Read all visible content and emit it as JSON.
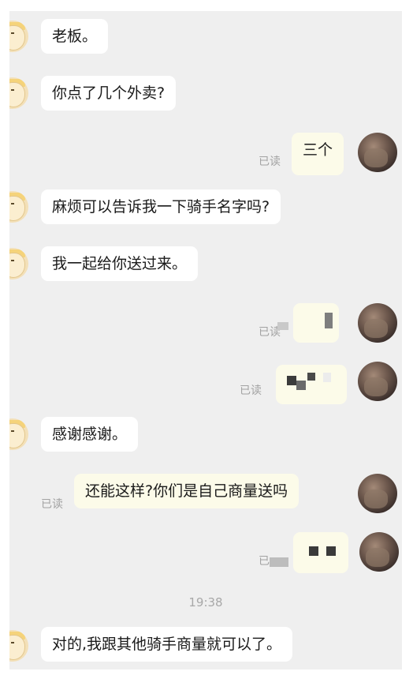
{
  "chat": {
    "messages": [
      {
        "side": "left",
        "text": "老板。"
      },
      {
        "side": "left",
        "text": "你点了几个外卖?"
      },
      {
        "side": "right",
        "text": "三个",
        "status": "已读"
      },
      {
        "side": "left",
        "text": "麻烦可以告诉我一下骑手名字吗?"
      },
      {
        "side": "left",
        "text": "我一起给你送过来。"
      },
      {
        "side": "right",
        "text": "",
        "status": "已读",
        "censored": true
      },
      {
        "side": "right",
        "text": "",
        "status": "已读",
        "censored": true
      },
      {
        "side": "left",
        "text": "感谢感谢。"
      },
      {
        "side": "right",
        "text": "还能这样?你们是自己商量送吗",
        "status": "已读"
      },
      {
        "side": "right",
        "text": "",
        "status": "已读",
        "censored": true
      },
      {
        "side": "left",
        "text": "对的,我跟其他骑手商量就可以了。"
      }
    ],
    "timestamp": "19:38"
  },
  "colors": {
    "background": "#efefef",
    "left_bubble": "#ffffff",
    "right_bubble": "#fcfbe9",
    "read_status": "#a2a2a2"
  },
  "icons": {
    "left_avatar": "cartoon-person-avatar",
    "right_avatar": "photo-avatar"
  }
}
